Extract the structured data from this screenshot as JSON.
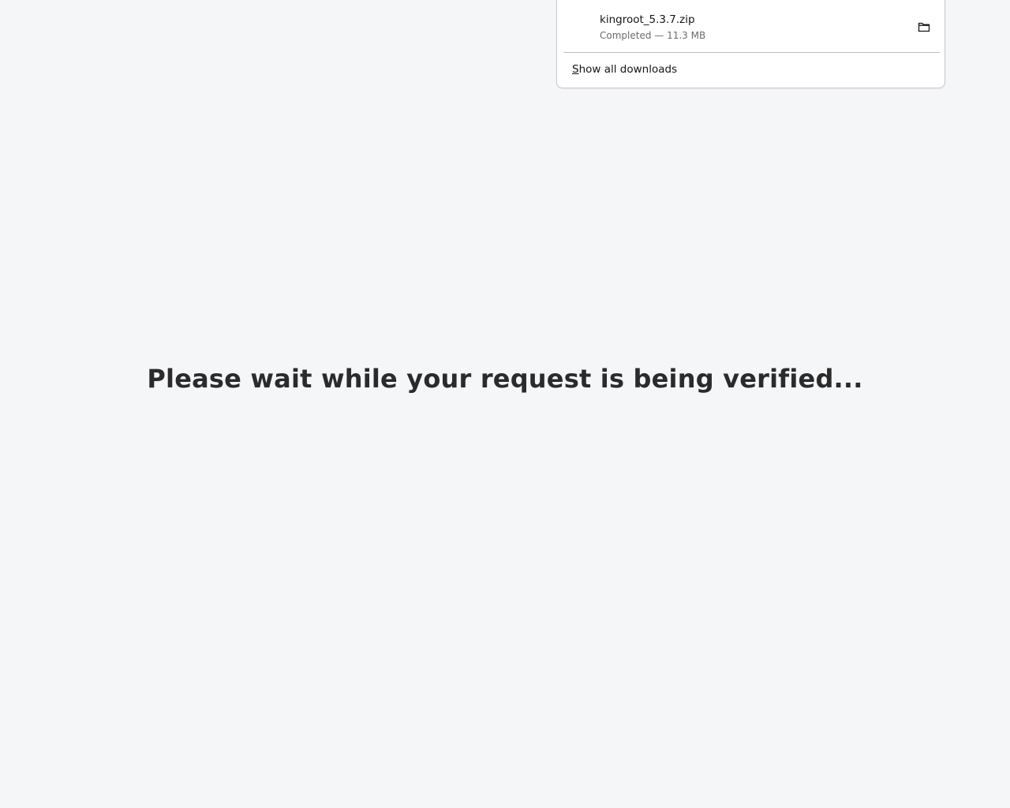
{
  "downloads_panel": {
    "items": [
      {
        "file_name": "kingroot_5.3.7.zip",
        "status": "Completed — 11.3 MB",
        "icon": "file-icon",
        "action_icon": "folder-icon"
      }
    ],
    "show_all": {
      "access_key": "S",
      "rest": "how all downloads"
    }
  },
  "page": {
    "message": "Please wait while your request is being verified..."
  },
  "colors": {
    "background": "#f5f6f8",
    "message_text": "#2b2b2b",
    "panel_background": "#ffffff",
    "panel_border": "#c9c9ce",
    "secondary_text": "#6b6b70"
  }
}
